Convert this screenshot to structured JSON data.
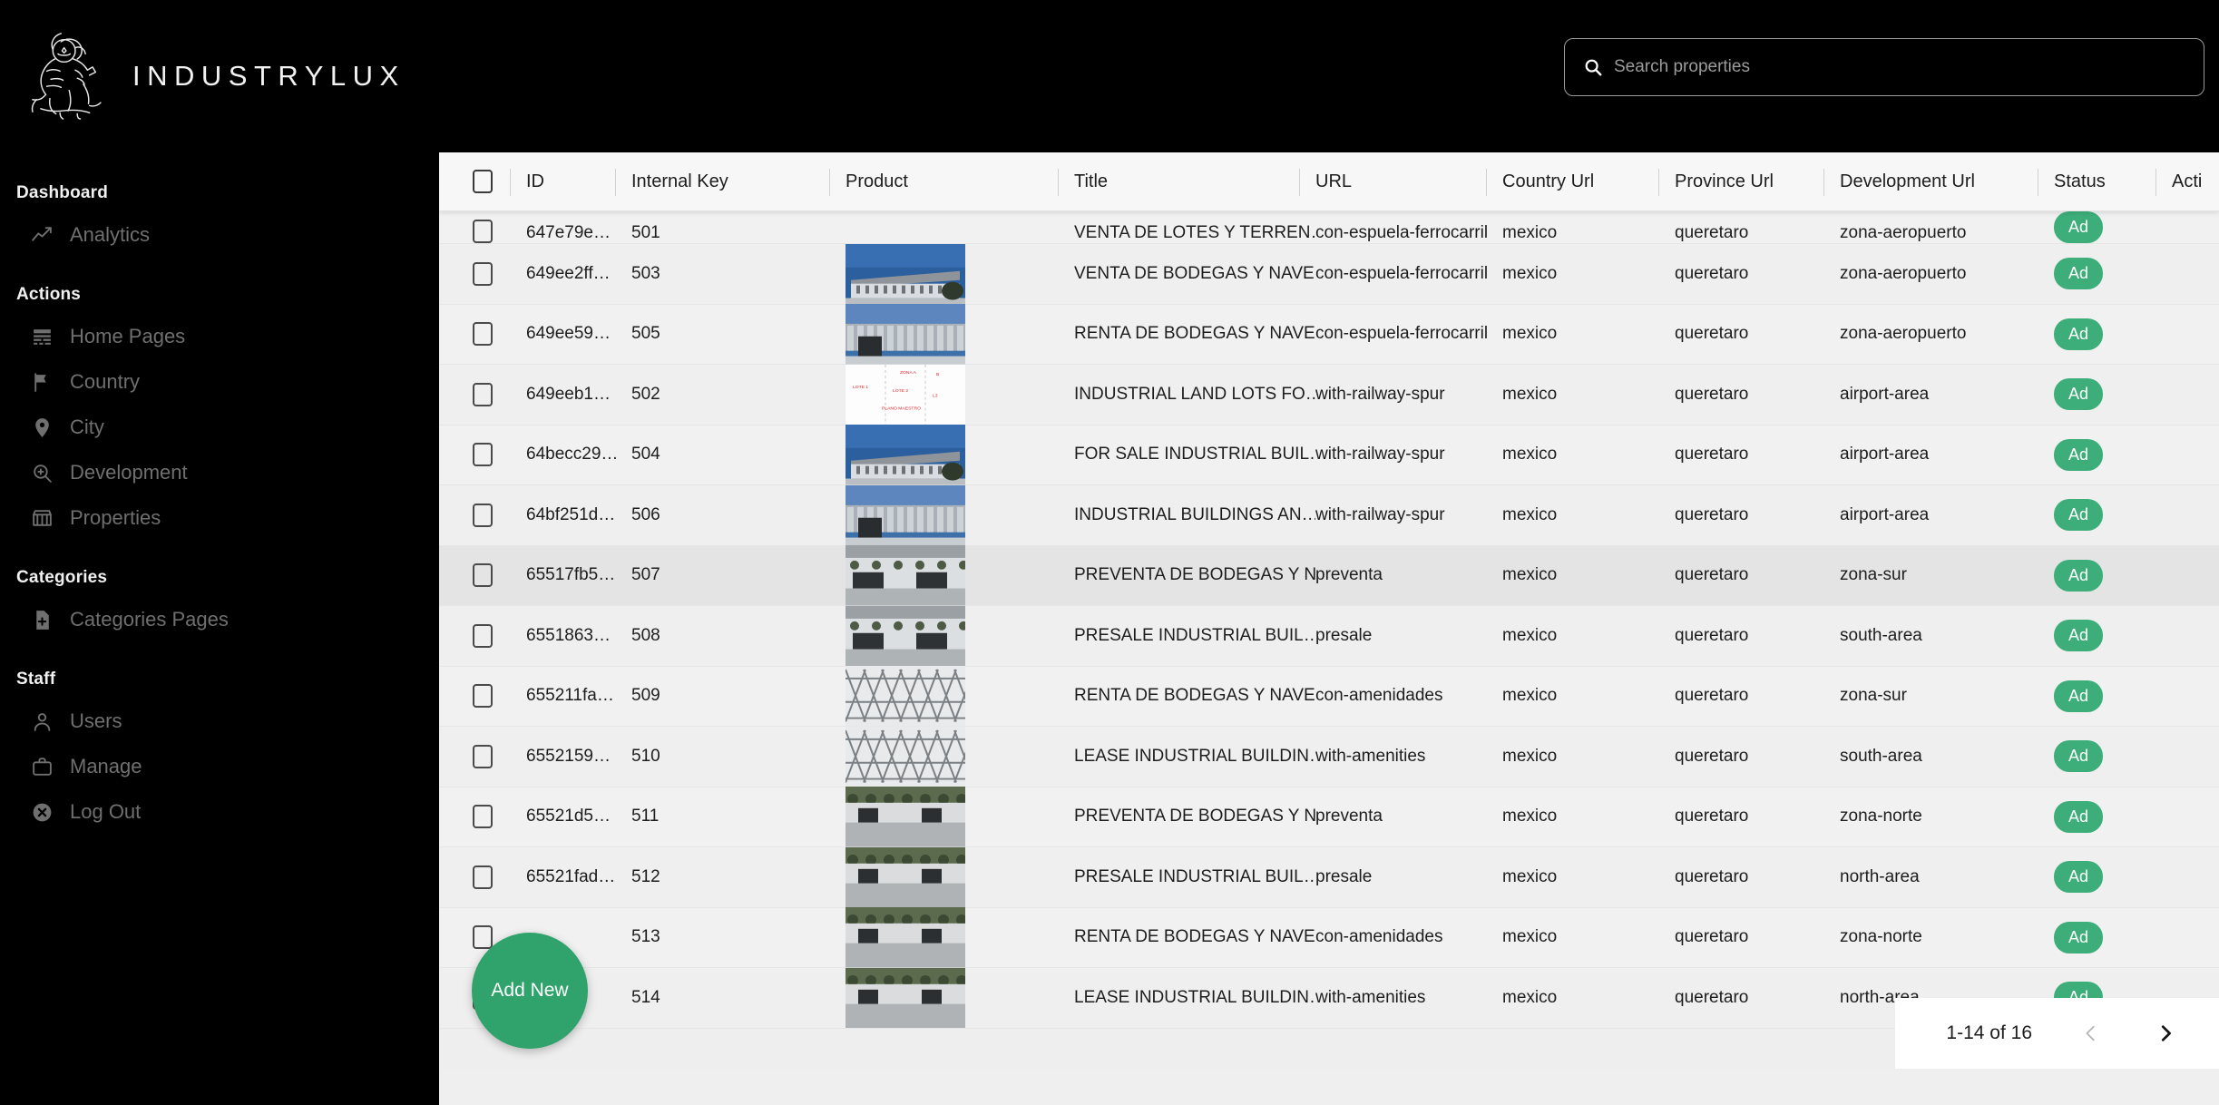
{
  "brand": {
    "name": "INDUSTRYLUX",
    "logo_icon": "lion-crest-icon"
  },
  "search": {
    "placeholder": "Search properties",
    "value": "",
    "icon": "search-icon"
  },
  "sidebar": {
    "groups": [
      {
        "title": "Dashboard",
        "items": [
          {
            "label": "Analytics",
            "icon": "trending-up-icon"
          }
        ]
      },
      {
        "title": "Actions",
        "items": [
          {
            "label": "Home Pages",
            "icon": "layout-rows-icon"
          },
          {
            "label": "Country",
            "icon": "flag-icon"
          },
          {
            "label": "City",
            "icon": "map-pin-icon"
          },
          {
            "label": "Development",
            "icon": "search-plus-icon"
          },
          {
            "label": "Properties",
            "icon": "storefront-icon"
          }
        ]
      },
      {
        "title": "Categories",
        "items": [
          {
            "label": "Categories Pages",
            "icon": "file-plus-icon"
          }
        ]
      },
      {
        "title": "Staff",
        "items": [
          {
            "label": "Users",
            "icon": "user-icon"
          },
          {
            "label": "Manage",
            "icon": "briefcase-icon"
          },
          {
            "label": "Log Out",
            "icon": "close-circle-icon"
          }
        ]
      }
    ]
  },
  "table": {
    "columns": [
      "ID",
      "Internal Key",
      "Product",
      "Title",
      "URL",
      "Country Url",
      "Province Url",
      "Development Url",
      "Status",
      "Acti"
    ],
    "status_color": "#3DAE79",
    "rows": [
      {
        "id": "647e79e…",
        "key": "501",
        "thumb": "site-plan-thumb",
        "title": "VENTA DE LOTES Y TERREN…",
        "url": "con-espuela-ferrocarril",
        "country": "mexico",
        "province": "queretaro",
        "development": "zona-aeropuerto",
        "status": "Ad",
        "clipped": true,
        "highlight": false
      },
      {
        "id": "649ee2ff…",
        "key": "503",
        "thumb": "warehouse-blue-sky-thumb",
        "title": "VENTA DE BODEGAS Y NAVE…",
        "url": "con-espuela-ferrocarril",
        "country": "mexico",
        "province": "queretaro",
        "development": "zona-aeropuerto",
        "status": "Ad",
        "clipped": false,
        "highlight": false
      },
      {
        "id": "649ee59…",
        "key": "505",
        "thumb": "warehouse-loading-dock-thumb",
        "title": "RENTA DE BODEGAS Y NAVE…",
        "url": "con-espuela-ferrocarril",
        "country": "mexico",
        "province": "queretaro",
        "development": "zona-aeropuerto",
        "status": "Ad",
        "clipped": false,
        "highlight": false
      },
      {
        "id": "649eeb1…",
        "key": "502",
        "thumb": "site-plan-thumb",
        "title": "INDUSTRIAL LAND LOTS FO…",
        "url": "with-railway-spur",
        "country": "mexico",
        "province": "queretaro",
        "development": "airport-area",
        "status": "Ad",
        "clipped": false,
        "highlight": false
      },
      {
        "id": "64becc29…",
        "key": "504",
        "thumb": "warehouse-blue-sky-thumb",
        "title": "FOR SALE INDUSTRIAL BUIL…",
        "url": "with-railway-spur",
        "country": "mexico",
        "province": "queretaro",
        "development": "airport-area",
        "status": "Ad",
        "clipped": false,
        "highlight": false
      },
      {
        "id": "64bf251d…",
        "key": "506",
        "thumb": "warehouse-loading-dock-thumb",
        "title": "INDUSTRIAL BUILDINGS AN…",
        "url": "with-railway-spur",
        "country": "mexico",
        "province": "queretaro",
        "development": "airport-area",
        "status": "Ad",
        "clipped": false,
        "highlight": false
      },
      {
        "id": "65517fb5…",
        "key": "507",
        "thumb": "concrete-building-thumb",
        "title": "PREVENTA DE BODEGAS Y N…",
        "url": "preventa",
        "country": "mexico",
        "province": "queretaro",
        "development": "zona-sur",
        "status": "Ad",
        "clipped": false,
        "highlight": true
      },
      {
        "id": "6551863…",
        "key": "508",
        "thumb": "concrete-building-thumb",
        "title": "PRESALE INDUSTRIAL BUIL…",
        "url": "presale",
        "country": "mexico",
        "province": "queretaro",
        "development": "south-area",
        "status": "Ad",
        "clipped": false,
        "highlight": false
      },
      {
        "id": "655211fa…",
        "key": "509",
        "thumb": "steel-structure-thumb",
        "title": "RENTA DE BODEGAS Y NAVE…",
        "url": "con-amenidades",
        "country": "mexico",
        "province": "queretaro",
        "development": "zona-sur",
        "status": "Ad",
        "clipped": false,
        "highlight": false
      },
      {
        "id": "6552159…",
        "key": "510",
        "thumb": "steel-structure-thumb",
        "title": "LEASE INDUSTRIAL BUILDIN…",
        "url": "with-amenities",
        "country": "mexico",
        "province": "queretaro",
        "development": "south-area",
        "status": "Ad",
        "clipped": false,
        "highlight": false
      },
      {
        "id": "65521d5…",
        "key": "511",
        "thumb": "glass-facade-thumb",
        "title": "PREVENTA DE BODEGAS Y N…",
        "url": "preventa",
        "country": "mexico",
        "province": "queretaro",
        "development": "zona-norte",
        "status": "Ad",
        "clipped": false,
        "highlight": false
      },
      {
        "id": "65521fad…",
        "key": "512",
        "thumb": "glass-facade-thumb",
        "title": "PRESALE INDUSTRIAL BUIL…",
        "url": "presale",
        "country": "mexico",
        "province": "queretaro",
        "development": "north-area",
        "status": "Ad",
        "clipped": false,
        "highlight": false
      },
      {
        "id": "",
        "key": "513",
        "thumb": "paved-yard-thumb",
        "title": "RENTA DE BODEGAS Y NAVE…",
        "url": "con-amenidades",
        "country": "mexico",
        "province": "queretaro",
        "development": "zona-norte",
        "status": "Ad",
        "clipped": false,
        "highlight": false
      },
      {
        "id": "",
        "key": "514",
        "thumb": "paved-yard-thumb",
        "title": "LEASE INDUSTRIAL BUILDIN…",
        "url": "with-amenities",
        "country": "mexico",
        "province": "queretaro",
        "development": "north-area",
        "status": "Ad",
        "clipped": false,
        "highlight": false
      }
    ]
  },
  "fab": {
    "label": "Add New"
  },
  "pagination": {
    "range_label": "1-14 of 16",
    "prev_icon": "chevron-left-icon",
    "next_icon": "chevron-right-icon",
    "prev_enabled": false,
    "next_enabled": true
  }
}
